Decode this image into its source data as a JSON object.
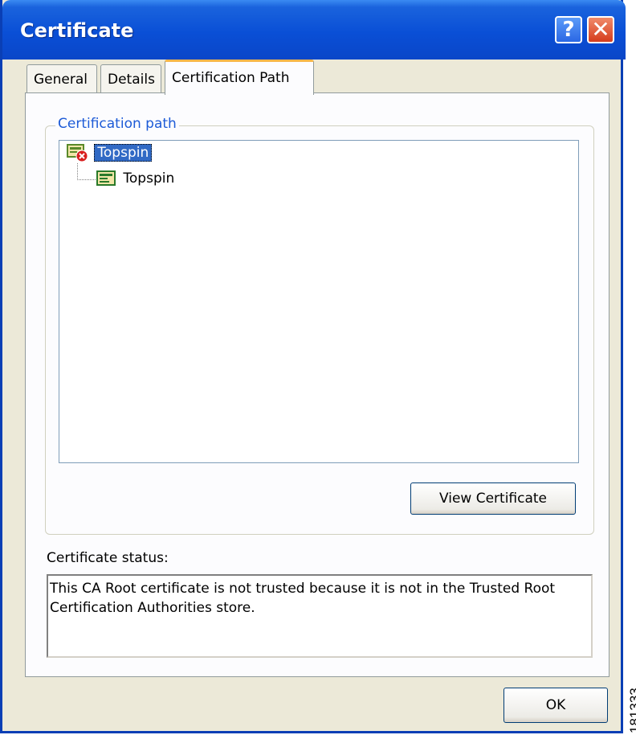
{
  "window": {
    "title": "Certificate",
    "help_label": "?",
    "close_label": "✕"
  },
  "tabs": [
    {
      "label": "General"
    },
    {
      "label": "Details"
    },
    {
      "label": "Certification Path",
      "selected": true
    }
  ],
  "certification_path": {
    "group_label": "Certification path",
    "tree": [
      {
        "label": "Topspin",
        "icon": "certificate-error-icon",
        "selected": true
      },
      {
        "label": "Topspin",
        "icon": "certificate-icon",
        "selected": false
      }
    ],
    "view_button_label": "View Certificate"
  },
  "status": {
    "label": "Certificate status:",
    "text": "This CA Root certificate is not trusted because it is not in the Trusted Root Certification Authorities store."
  },
  "ok_label": "OK",
  "figure_id": "181333",
  "colors": {
    "titlebar": "#0a4fd6",
    "selection": "#316ac5",
    "group_label": "#1d5bd7",
    "active_tab_accent": "#f7b64a"
  }
}
